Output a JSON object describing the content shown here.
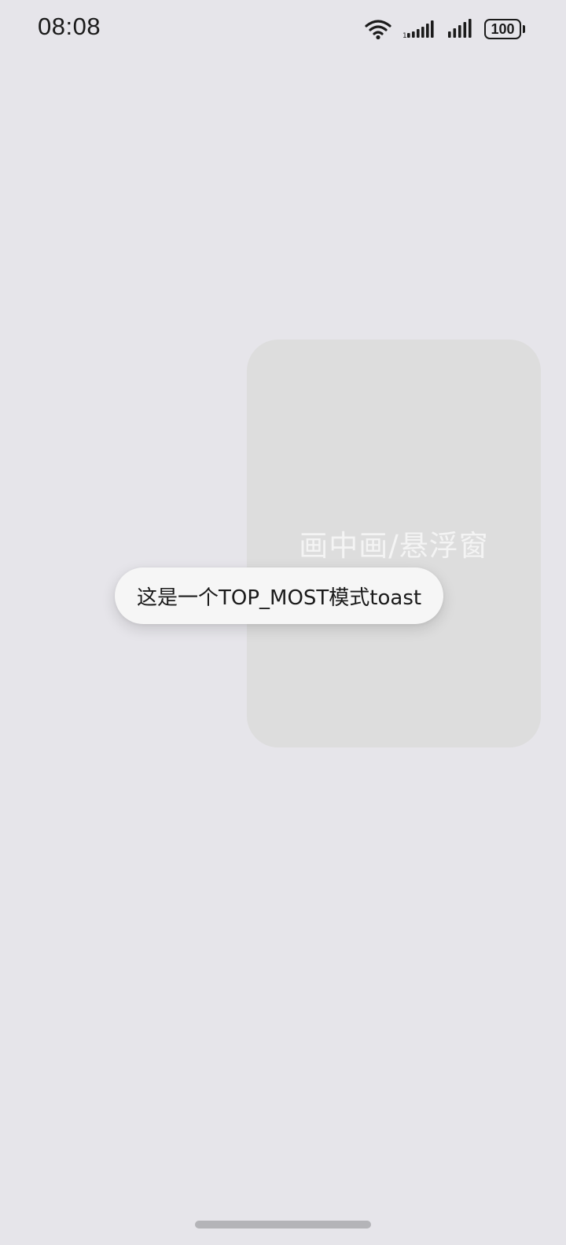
{
  "status_bar": {
    "time": "08:08",
    "battery_level": "100",
    "icons": [
      "wifi-icon",
      "cellular-signal-icon",
      "cellular-signal-icon",
      "battery-icon"
    ]
  },
  "pip_window": {
    "label": "画中画/悬浮窗"
  },
  "toast": {
    "message": "这是一个TOP_MOST模式toast"
  },
  "colors": {
    "background": "#e6e5ea",
    "pip_background": "#dddddd",
    "toast_background": "#f6f6f6",
    "text_dark": "#1b1b1b",
    "home_indicator": "#b4b4b8"
  }
}
